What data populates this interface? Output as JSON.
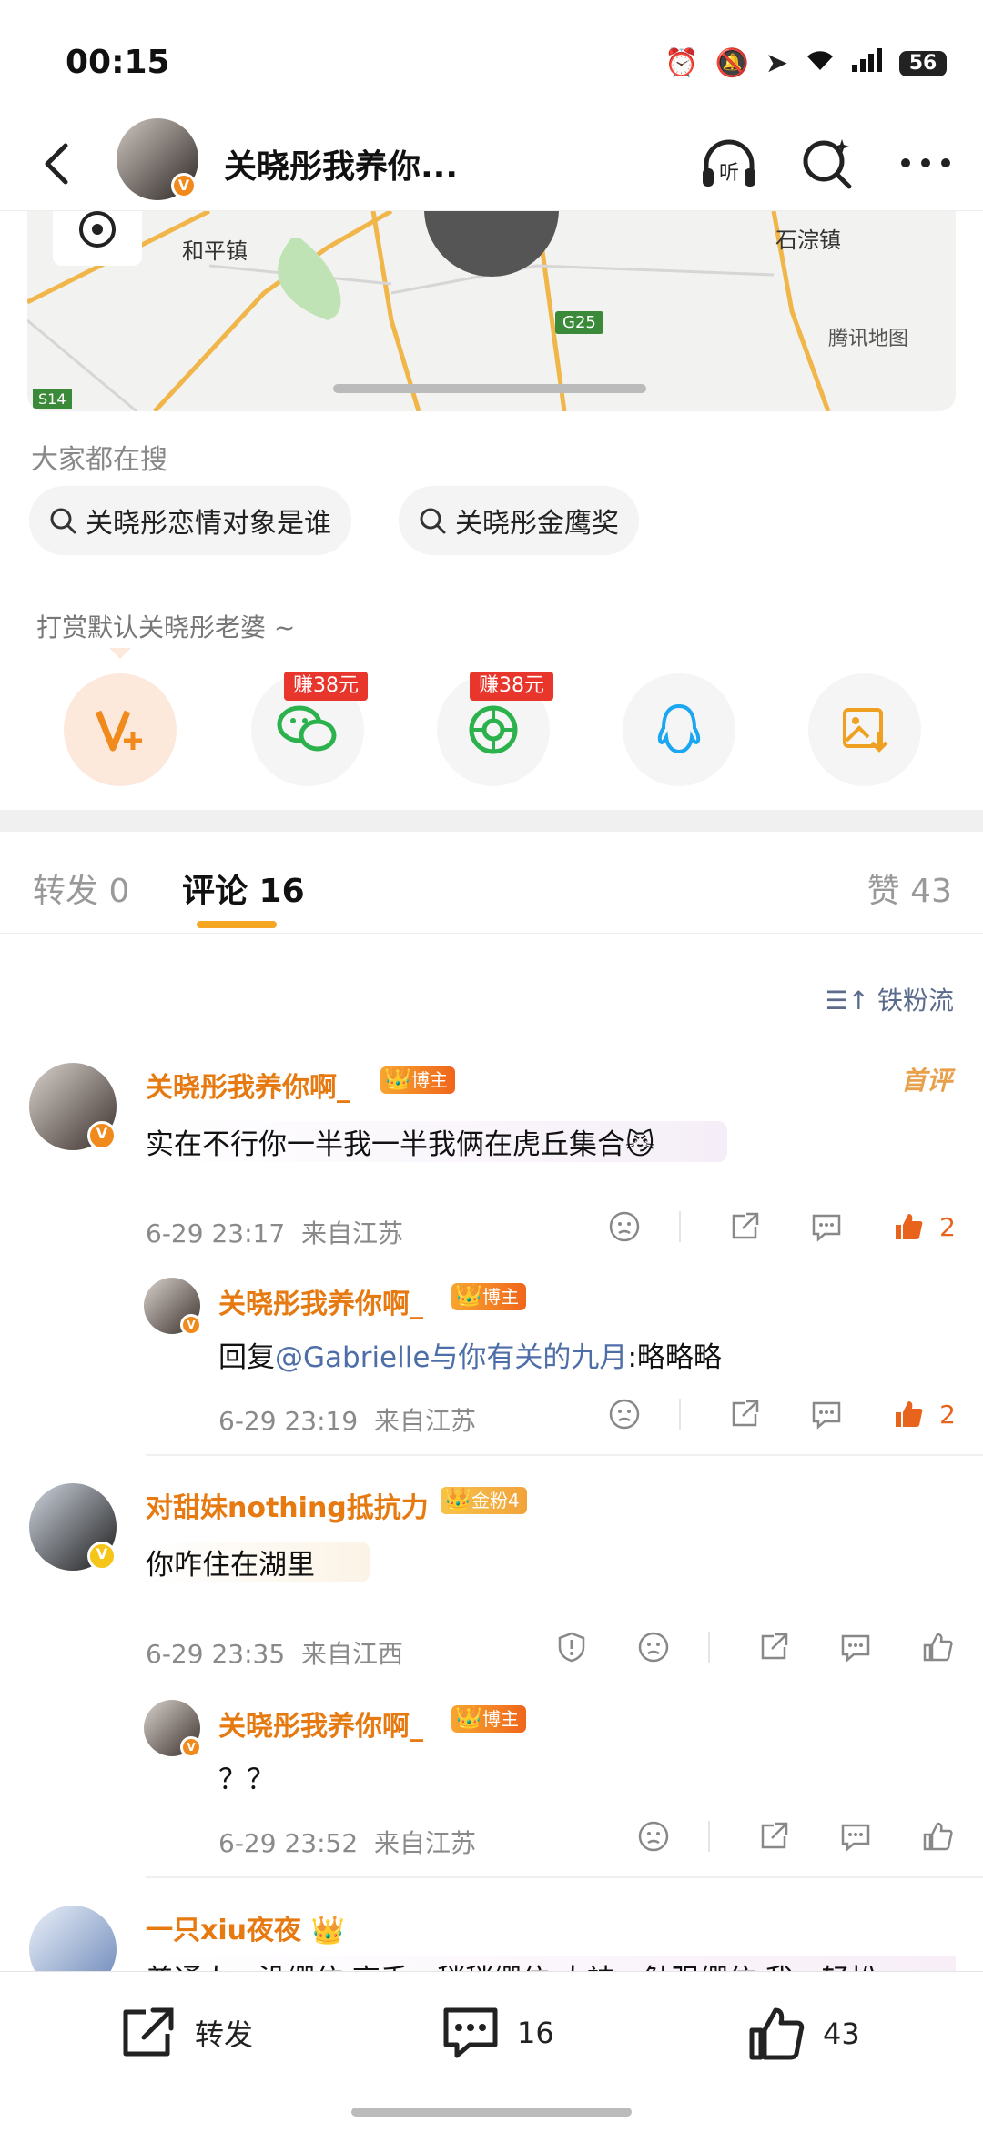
{
  "status": {
    "time": "00:15",
    "battery": "56"
  },
  "header": {
    "title": "关晓彤我养你..."
  },
  "map": {
    "label_town1": "和平镇",
    "label_town2": "石淙镇",
    "road": "G25",
    "road2": "S14",
    "brand": "腾讯地图"
  },
  "hot_search": {
    "title": "大家都在搜",
    "chips": [
      "关晓彤恋情对象是谁",
      "关晓彤金鹰奖"
    ]
  },
  "reward": {
    "title": "打赏默认关晓彤老婆 ~",
    "earn1": "赚38元",
    "earn2": "赚38元"
  },
  "tabs": {
    "repost": "转发 0",
    "comment": "评论 16",
    "likes": "赞 43"
  },
  "sort": {
    "label": "铁粉流"
  },
  "comments": [
    {
      "name": "关晓彤我养你啊_",
      "badge": "博主",
      "text": "实在不行你一半我一半我俩在虎丘集合",
      "emoji": "😼",
      "time": "6-29 23:17",
      "loc": "来自江苏",
      "likes": "2",
      "first": "首评"
    },
    {
      "name": "关晓彤我养你啊_",
      "badge": "博主",
      "reply_prefix": "回复",
      "mention": "@Gabrielle与你有关的九月",
      "text": ":略略略",
      "time": "6-29 23:19",
      "loc": "来自江苏",
      "likes": "2"
    },
    {
      "name": "对甜妹nothing抵抗力",
      "badge": "金粉4",
      "text": "你咋住在湖里",
      "time": "6-29 23:35",
      "loc": "来自江西"
    },
    {
      "name": "关晓彤我养你啊_",
      "badge": "博主",
      "text": "？？",
      "time": "6-29 23:52",
      "loc": "来自江苏"
    },
    {
      "name": "一只xiu夜夜",
      "text": "普通人：没绷住 高手：稍稍绷住 大神：勉强绷住 我：轻松"
    }
  ],
  "bottom": {
    "repost": "转发",
    "comments": "16",
    "likes": "43"
  }
}
